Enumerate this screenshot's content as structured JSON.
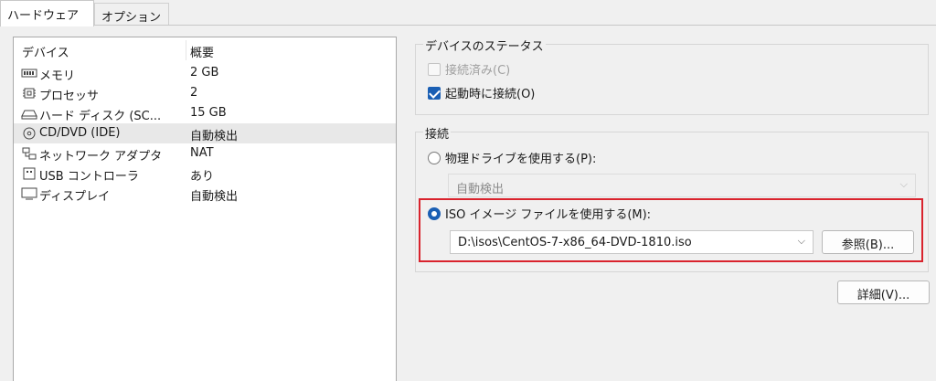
{
  "tabs": [
    {
      "label": "ハードウェア"
    },
    {
      "label": "オプション"
    }
  ],
  "device_list": {
    "headers": {
      "device": "デバイス",
      "summary": "概要"
    },
    "rows": [
      {
        "icon": "memory-icon",
        "device": "メモリ",
        "summary": "2 GB"
      },
      {
        "icon": "processor-icon",
        "device": "プロセッサ",
        "summary": "2"
      },
      {
        "icon": "hard-disk-icon",
        "device": "ハード ディスク (SC...",
        "summary": "15 GB"
      },
      {
        "icon": "cd-dvd-icon",
        "device": "CD/DVD (IDE)",
        "summary": "自動検出"
      },
      {
        "icon": "network-adapter-icon",
        "device": "ネットワーク アダプタ",
        "summary": "NAT"
      },
      {
        "icon": "usb-controller-icon",
        "device": "USB コントローラ",
        "summary": "あり"
      },
      {
        "icon": "display-icon",
        "device": "ディスプレイ",
        "summary": "自動検出"
      }
    ],
    "selected_index": 3
  },
  "device_status": {
    "title": "デバイスのステータス",
    "connected": {
      "label": "接続済み(C)",
      "checked": false,
      "disabled": true
    },
    "connect_at_power_on": {
      "label": "起動時に接続(O)",
      "checked": true
    }
  },
  "connection": {
    "title": "接続",
    "physical_drive": {
      "label": "物理ドライブを使用する(P):",
      "selected": false
    },
    "physical_drive_value": "自動検出",
    "iso_image": {
      "label": "ISO イメージ ファイルを使用する(M):",
      "selected": true
    },
    "iso_path": "D:\\isos\\CentOS-7-x86_64-DVD-1810.iso",
    "browse_label": "参照(B)..."
  },
  "advanced_label": "詳細(V)...",
  "colors": {
    "accent": "#1a5fb4",
    "highlight": "#d9232d"
  }
}
